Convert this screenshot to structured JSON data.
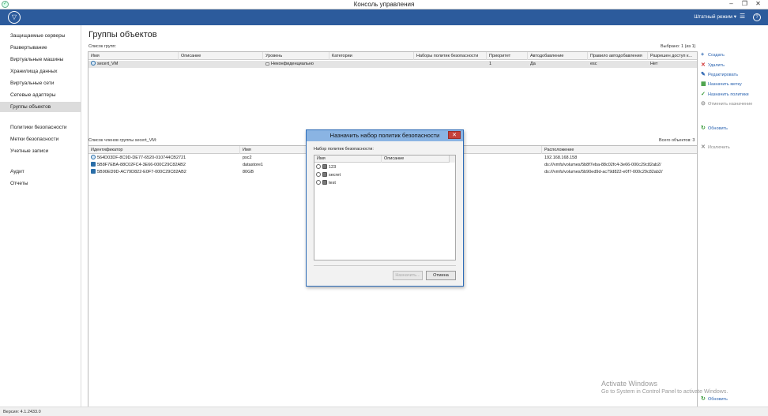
{
  "window": {
    "title": "Консоль управления",
    "min": "–",
    "max": "❐",
    "close": "✕"
  },
  "topbar": {
    "mode_label": "Штатный режим ▾"
  },
  "sidebar": {
    "items": [
      {
        "label": "Защищаемые серверы"
      },
      {
        "label": "Развертывание"
      },
      {
        "label": "Виртуальные машины"
      },
      {
        "label": "Хранилища данных"
      },
      {
        "label": "Виртуальные сети"
      },
      {
        "label": "Сетевые адаптеры"
      },
      {
        "label": "Группы объектов"
      },
      {
        "label": "Политики безопасности"
      },
      {
        "label": "Метки безопасности"
      },
      {
        "label": "Учетные записи"
      },
      {
        "label": "Аудит"
      },
      {
        "label": "Отчеты"
      }
    ]
  },
  "main": {
    "title": "Группы объектов",
    "groups_list_label": "Список групп:",
    "selected_text": "Выбрано: 1 (из 1)",
    "groups_table": {
      "columns": [
        "Имя",
        "Описание",
        "Уровень",
        "Категории",
        "Наборы политик безопасности",
        "Приоритет",
        "Автодобавление",
        "Правило автодобавления",
        "Разрешен доступ к..."
      ],
      "rows": [
        [
          "secert_VM",
          "",
          "Неконфиденциально",
          "",
          "",
          "1",
          "Да",
          "esc",
          "Нет"
        ]
      ]
    },
    "members_label": "Список членов группы secert_VM:",
    "total_text": "Всего объектов: 3",
    "members_table": {
      "columns": [
        "Идентификатор",
        "Имя",
        "Расположение"
      ],
      "rows": [
        [
          "564D03DF-8C9D-DE77-6520-010744CB2721",
          "psc2",
          "192.168.168.158"
        ],
        [
          "5B8F7EBA-88C02FC4-3E66-000C29C82AB2",
          "datastore1",
          "ds:///vmfs/volumes/5b8f7eba-88c02fc4-3e66-000c29c82ab2/"
        ],
        [
          "5B90ED9D-AC79D822-E0F7-000C29C82AB2",
          "80GB",
          "ds:///vmfs/volumes/5b90ed9d-ac79d822-e0f7-000c29c82ab2/"
        ]
      ]
    }
  },
  "actions": {
    "create": "Создать",
    "delete": "Удалить",
    "edit": "Редактировать",
    "assign_label": "Назначить метку",
    "assign_policies": "Назначить политики",
    "cancel_assign": "Отменить назначение",
    "refresh": "Обновить",
    "exclude": "Исключить",
    "refresh_bottom": "Обновить"
  },
  "dialog": {
    "title": "Назначить набор политик безопасности",
    "label": "Набор политик безопасности:",
    "columns": [
      "Имя",
      "Описание"
    ],
    "items": [
      {
        "name": "123",
        "description": ""
      },
      {
        "name": "secret",
        "description": ""
      },
      {
        "name": "test",
        "description": ""
      }
    ],
    "assign_button": "Назначить...",
    "cancel_button": "Отмена"
  },
  "status": {
    "version": "Версия: 4.1.2433.0"
  },
  "watermark": {
    "line1": "Activate Windows",
    "line2": "Go to System in Control Panel to activate Windows."
  }
}
